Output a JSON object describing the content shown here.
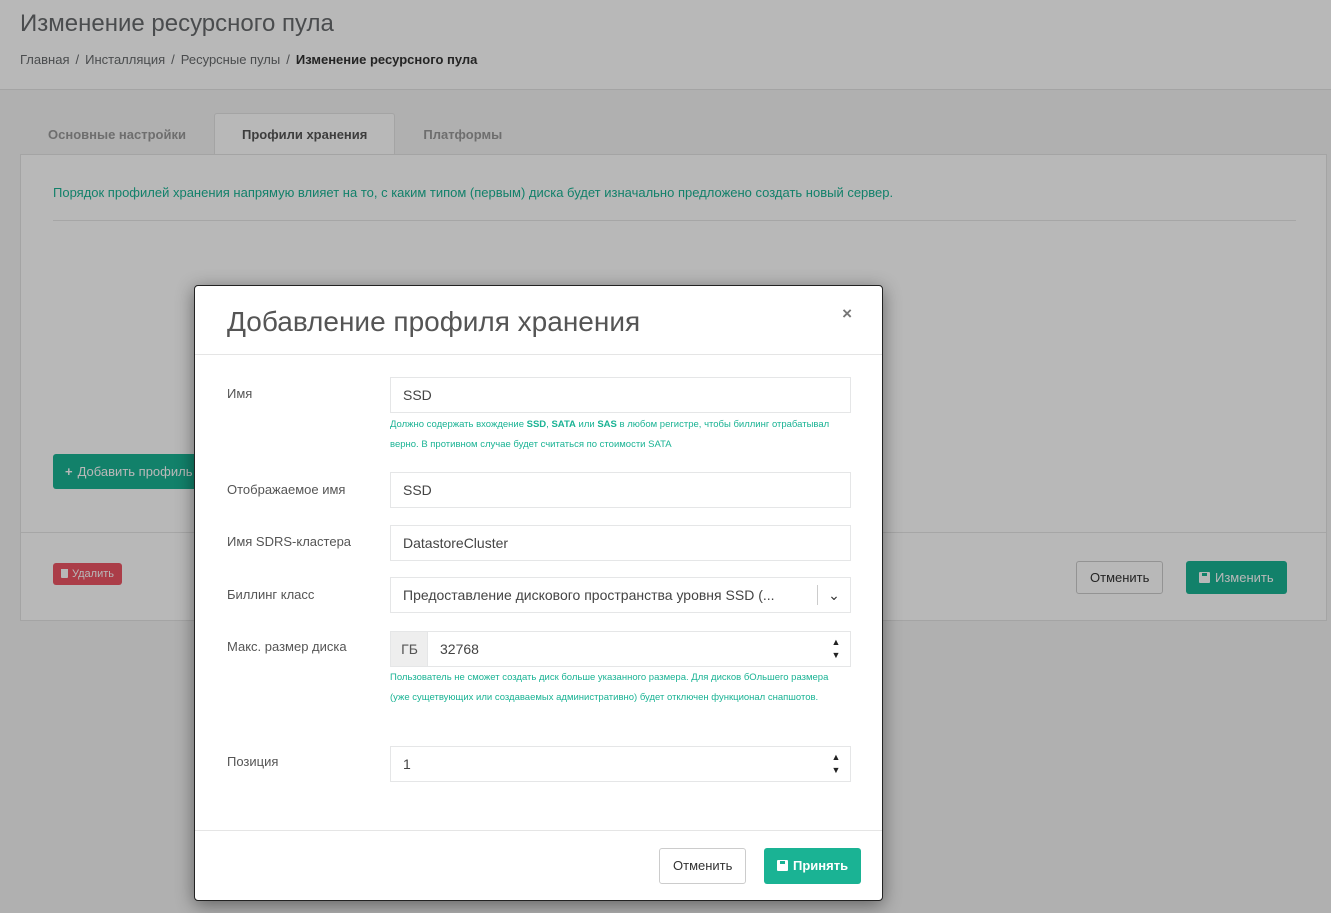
{
  "page": {
    "title": "Изменение ресурсного пула",
    "breadcrumbs": [
      "Главная",
      "Инсталляция",
      "Ресурсные пулы",
      "Изменение ресурсного пула"
    ],
    "breadcrumb_sep": "/"
  },
  "tabs": [
    {
      "label": "Основные настройки",
      "active": false
    },
    {
      "label": "Профили хранения",
      "active": true
    },
    {
      "label": "Платформы",
      "active": false
    }
  ],
  "panel": {
    "info": "Порядок профилей хранения напрямую влияет на то, с каким типом (первым) диска будет изначально предложено создать новый сервер.",
    "add_button": "Добавить профиль хранения",
    "delete_button": "Удалить",
    "cancel_button": "Отменить",
    "save_button": "Изменить"
  },
  "modal": {
    "title": "Добавление профиля хранения",
    "close": "×",
    "fields": {
      "name": {
        "label": "Имя",
        "value": "SSD",
        "hint_part1": "Должно содержать вхождение ",
        "hint_b1": "SSD",
        "hint_part2": ", ",
        "hint_b2": "SATA",
        "hint_part3": " или ",
        "hint_b3": "SAS",
        "hint_part4": " в любом регистре, чтобы биллинг отрабатывал верно. В противном случае будет считаться по стоимости SATA"
      },
      "display_name": {
        "label": "Отображаемое имя",
        "value": "SSD"
      },
      "sdrs_cluster": {
        "label": "Имя SDRS-кластера",
        "value": "DatastoreCluster"
      },
      "billing_class": {
        "label": "Биллинг класс",
        "value": "Предоставление дискового пространства уровня SSD (..."
      },
      "max_disk": {
        "label": "Макс. размер диска",
        "unit": "ГБ",
        "value": "32768",
        "hint": "Пользователь не сможет создать диск больше указанного размера. Для дисков бОльшего размера (уже сущетвующих или создаваемых административно) будет отключен функционал снапшотов."
      },
      "position": {
        "label": "Позиция",
        "value": "1"
      }
    },
    "cancel_button": "Отменить",
    "accept_button": "Принять"
  },
  "colors": {
    "accent": "#1ab394",
    "danger": "#ed5565"
  }
}
